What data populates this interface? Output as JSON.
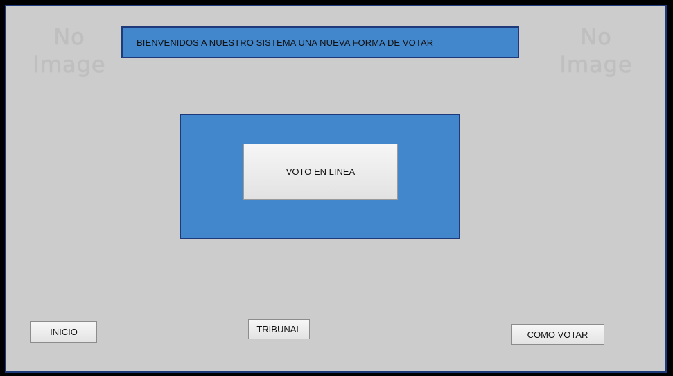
{
  "images": {
    "left_placeholder": [
      "No",
      "Image"
    ],
    "right_placeholder": [
      "No",
      "Image"
    ]
  },
  "banner": {
    "text": "BIENVENIDOS A NUESTRO SISTEMA UNA NUEVA FORMA DE VOTAR"
  },
  "main": {
    "vote_button_label": "VOTO EN LINEA"
  },
  "footer": {
    "inicio_label": "INICIO",
    "tribunal_label": "TRIBUNAL",
    "como_votar_label": "COMO VOTAR"
  },
  "colors": {
    "background": "#cccccc",
    "panel_blue": "#4287cc",
    "border_navy": "#1f3a7a"
  }
}
